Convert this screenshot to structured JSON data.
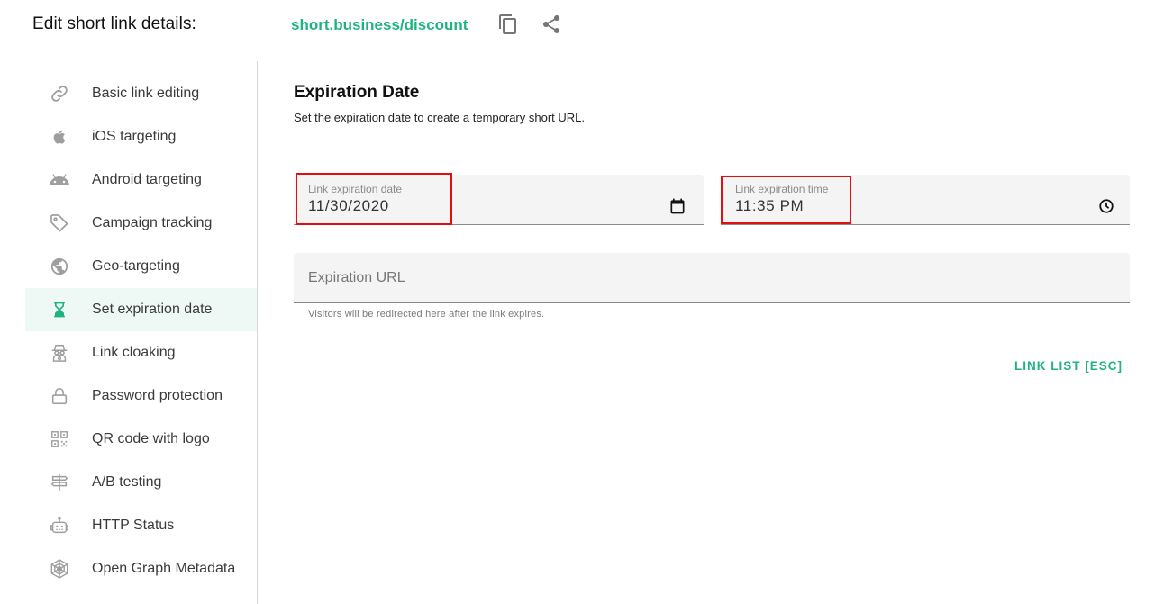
{
  "header": {
    "title": "Edit short link details:",
    "short_link": "short.business/discount",
    "copy_icon": "copy-icon",
    "share_icon": "share-icon"
  },
  "colors": {
    "accent": "#1fb47f",
    "active_bg": "#eef8f4",
    "highlight": "#e01010"
  },
  "sidebar": {
    "active_index": 5,
    "items": [
      {
        "label": "Basic link editing",
        "icon": "link-icon"
      },
      {
        "label": "iOS targeting",
        "icon": "apple-icon"
      },
      {
        "label": "Android targeting",
        "icon": "android-icon"
      },
      {
        "label": "Campaign tracking",
        "icon": "tag-icon"
      },
      {
        "label": "Geo-targeting",
        "icon": "globe-icon"
      },
      {
        "label": "Set expiration date",
        "icon": "hourglass-icon"
      },
      {
        "label": "Link cloaking",
        "icon": "spy-icon"
      },
      {
        "label": "Password protection",
        "icon": "lock-icon"
      },
      {
        "label": "QR code with logo",
        "icon": "qr-code-icon"
      },
      {
        "label": "A/B testing",
        "icon": "signpost-icon"
      },
      {
        "label": "HTTP Status",
        "icon": "robot-icon"
      },
      {
        "label": "Open Graph Metadata",
        "icon": "web-icon"
      }
    ]
  },
  "main": {
    "title": "Expiration Date",
    "subtitle": "Set the expiration date to create a temporary short URL.",
    "date_field": {
      "label": "Link expiration date",
      "value": "11/30/2020",
      "icon": "calendar-icon"
    },
    "time_field": {
      "label": "Link expiration time",
      "value": "11:35 PM",
      "icon": "clock-icon"
    },
    "url_field": {
      "placeholder": "Expiration URL",
      "value": "",
      "hint": "Visitors will be redirected here after the link expires."
    },
    "link_list_button": "LINK LIST [ESC]"
  }
}
